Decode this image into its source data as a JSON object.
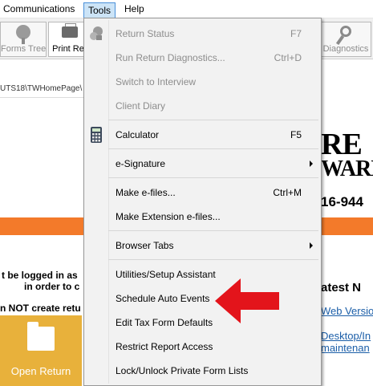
{
  "menubar": {
    "items": [
      {
        "label": "Communications"
      },
      {
        "label": "Tools"
      },
      {
        "label": "Help"
      }
    ]
  },
  "toolbar": {
    "forms_tree": "Forms Tree",
    "print": "Print Re",
    "diagnostics": "Diagnostics"
  },
  "address": "UTS18\\TWHomePage\\",
  "background": {
    "logo_line1": "RE",
    "logo_line2": "WARE",
    "phone": "16-944",
    "warning1": "t be logged in as",
    "warning2": "in order to c",
    "warning3": "n NOT create retu",
    "latest": "atest N",
    "link1": "Web Versio",
    "link2": "Desktop/In",
    "link3": "maintenan",
    "tile_label": "Open Return",
    "accent": "#f37a2a",
    "tile_color": "#e8b13b"
  },
  "tools_menu": {
    "items": [
      {
        "label": "Return Status",
        "shortcut": "F7",
        "disabled": true,
        "icon": "return-status-icon"
      },
      {
        "label": "Run Return Diagnostics...",
        "shortcut": "Ctrl+D",
        "disabled": true
      },
      {
        "label": "Switch to Interview",
        "disabled": true
      },
      {
        "label": "Client Diary",
        "disabled": true
      },
      {
        "label": "Calculator",
        "shortcut": "F5",
        "icon": "calculator-icon"
      },
      {
        "label": "e-Signature",
        "submenu": true
      },
      {
        "label": "Make e-files...",
        "shortcut": "Ctrl+M"
      },
      {
        "label": "Make Extension e-files..."
      },
      {
        "label": "Browser Tabs",
        "submenu": true
      },
      {
        "label": "Utilities/Setup Assistant"
      },
      {
        "label": "Schedule Auto Events"
      },
      {
        "label": "Edit Tax Form Defaults"
      },
      {
        "label": "Restrict Report Access"
      },
      {
        "label": "Lock/Unlock Private Form Lists"
      }
    ]
  },
  "annotation": {
    "arrow_color": "#e3141b"
  }
}
